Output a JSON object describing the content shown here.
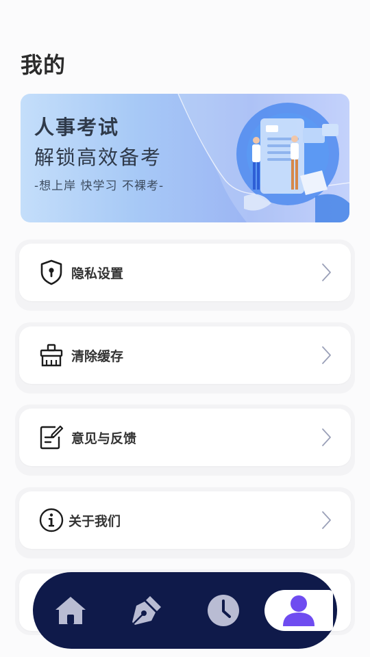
{
  "header": {
    "title": "我的"
  },
  "banner": {
    "title_line1": "人事考试",
    "title_line2": "解锁高效备考",
    "slogan": "-想上岸 快学习 不裸考-"
  },
  "menu": {
    "items": [
      {
        "label": "隐私设置",
        "icon": "shield-lock-icon"
      },
      {
        "label": "清除缓存",
        "icon": "broom-icon"
      },
      {
        "label": "意见与反馈",
        "icon": "edit-note-icon"
      },
      {
        "label": "关于我们",
        "icon": "info-icon"
      }
    ]
  },
  "bottom_nav": {
    "items": [
      {
        "icon": "home-icon",
        "active": false
      },
      {
        "icon": "pen-icon",
        "active": false
      },
      {
        "icon": "clock-icon",
        "active": false
      },
      {
        "icon": "user-icon",
        "active": true
      }
    ]
  },
  "colors": {
    "background": "#fbfbfc",
    "nav_bg": "#0f1a4a",
    "nav_icon_inactive": "#b9bcd3",
    "nav_icon_active": "#6f4cf0",
    "chevron": "#9aa0b8"
  }
}
